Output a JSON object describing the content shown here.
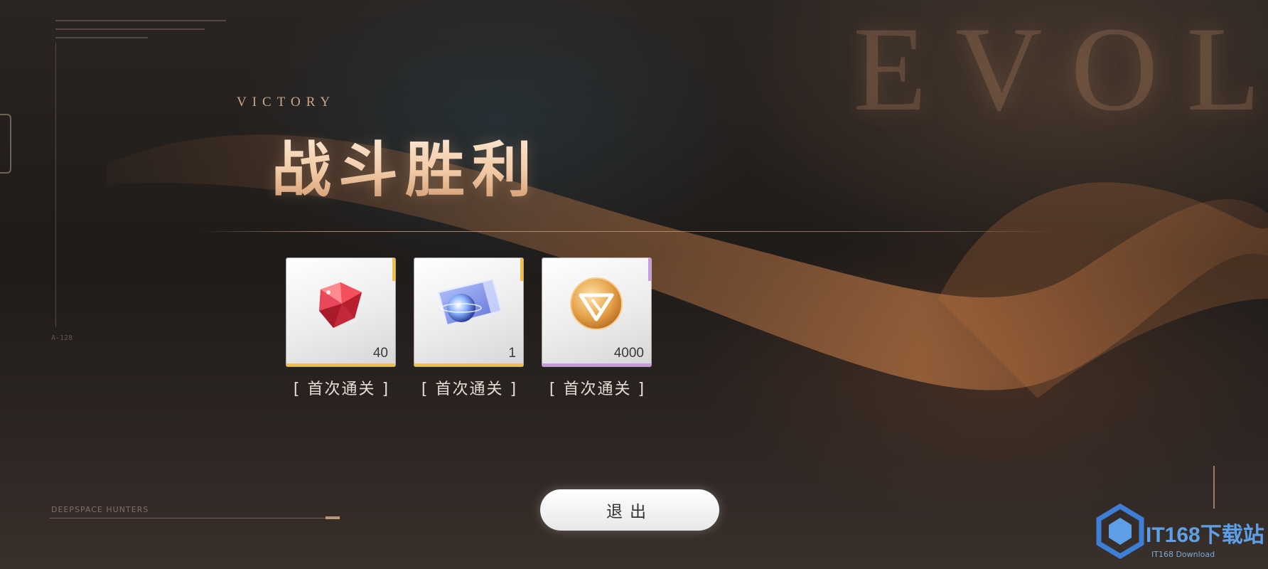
{
  "background": {
    "word": "EVOL",
    "footer_label": "DEEPSPACE HUNTERS",
    "small_tag": "A-128"
  },
  "header": {
    "title_en": "VICTORY",
    "title_cn": "战斗胜利"
  },
  "rewards": [
    {
      "icon": "red-diamond-icon",
      "amount": "40",
      "label": "[ 首次通关 ]",
      "rarity_color": "#f0c040"
    },
    {
      "icon": "star-ticket-icon",
      "amount": "1",
      "label": "[ 首次通关 ]",
      "rarity_color": "#f0c040"
    },
    {
      "icon": "gold-coin-icon",
      "amount": "4000",
      "label": "[ 首次通关 ]",
      "rarity_color": "#c89be0"
    }
  ],
  "actions": {
    "exit_label": "退出"
  },
  "watermark": {
    "main": "IT168下载站",
    "sub": "IT168 Download"
  },
  "colors": {
    "accent": "#e8b48c",
    "background": "#1f1b19",
    "button": "#f2f2f2"
  }
}
